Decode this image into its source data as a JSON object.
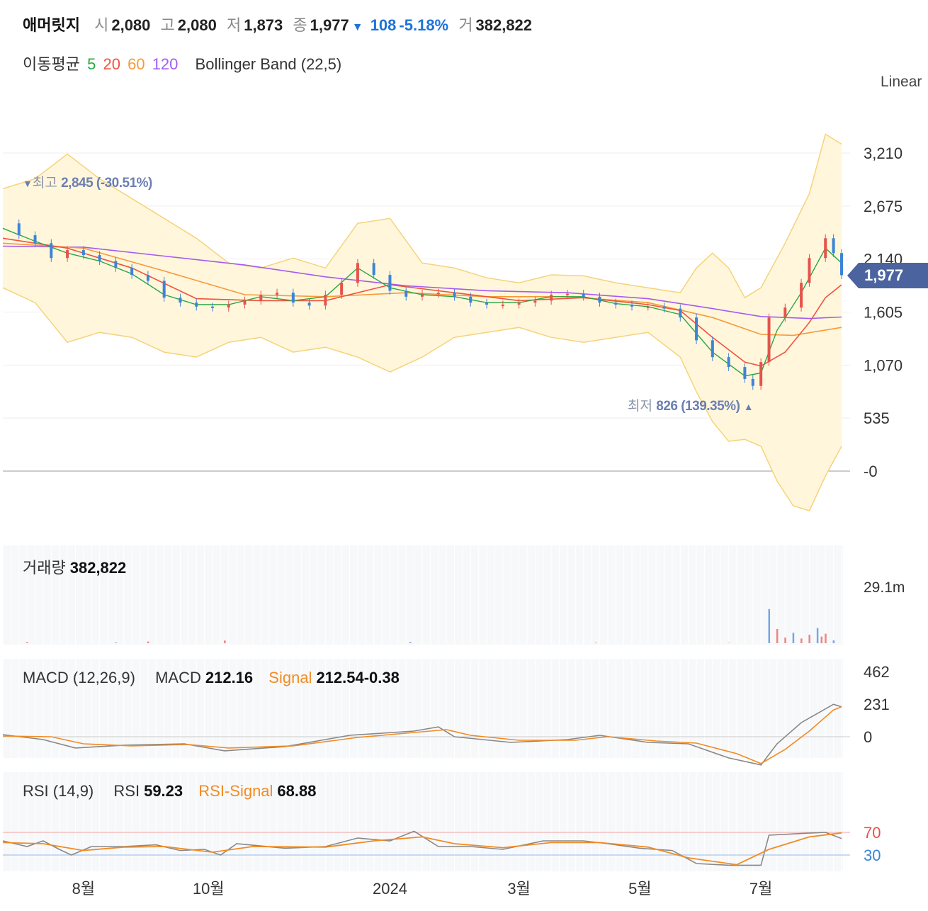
{
  "header": {
    "name": "애머릿지",
    "open_label": "시",
    "open": "2,080",
    "high_label": "고",
    "high": "2,080",
    "low_label": "저",
    "low": "1,873",
    "close_label": "종",
    "close": "1,977",
    "change_arrow": "▼",
    "change": "108",
    "change_pct": "-5.18%",
    "volume_label": "거",
    "volume": "382,822"
  },
  "indicators": {
    "ma_label": "이동평균",
    "ma_periods": [
      "5",
      "20",
      "60",
      "120"
    ],
    "ma_colors": [
      "#2aa744",
      "#f0533d",
      "#f59a3a",
      "#a55bf0"
    ],
    "bb_label": "Bollinger Band (22,5)",
    "scale_mode": "Linear"
  },
  "price_axis": {
    "ticks": [
      "3,210",
      "2,675",
      "2,140",
      "1,605",
      "1,070",
      "535",
      "-0"
    ],
    "current_price_tag": "1,977"
  },
  "annotations": {
    "high_marker": "▼",
    "high_label": "최고",
    "high_value": "2,845 (-30.51%)",
    "low_label": "최저",
    "low_value": "826 (139.35%)",
    "low_marker": "▲"
  },
  "volume_panel": {
    "label": "거래량",
    "value": "382,822",
    "axis_max": "29.1m"
  },
  "macd_panel": {
    "label": "MACD (12,26,9)",
    "macd_label": "MACD",
    "macd_value": "212.16",
    "signal_label": "Signal",
    "signal_value": "212.54",
    "hist_value": "-0.38",
    "ticks": [
      "462",
      "231",
      "0"
    ]
  },
  "rsi_panel": {
    "label": "RSI (14,9)",
    "rsi_label": "RSI",
    "rsi_value": "59.23",
    "signal_label": "RSI-Signal",
    "signal_value": "68.88",
    "ticks": [
      "70",
      "30"
    ]
  },
  "x_axis": {
    "ticks": [
      "8월",
      "10월",
      "2024",
      "3월",
      "5월",
      "7월"
    ]
  },
  "colors": {
    "up": "#e5534b",
    "down": "#3c84d8",
    "bb_fill": "#fff6dc",
    "bb_line": "#f6d37a",
    "signal": "#f28b23",
    "macd_line": "#888888",
    "tag_bg": "#4b64a0"
  },
  "chart_data": {
    "type": "line",
    "x_tick_labels": [
      "8월",
      "10월",
      "2024",
      "3월",
      "5월",
      "7월"
    ],
    "y_ticks": [
      3210,
      2675,
      2140,
      1605,
      1070,
      535,
      0
    ],
    "ylim": [
      -400,
      3500
    ],
    "close_path": [
      [
        0,
        2500
      ],
      [
        4,
        2380
      ],
      [
        8,
        2300
      ],
      [
        12,
        2150
      ],
      [
        16,
        2230
      ],
      [
        20,
        2180
      ],
      [
        24,
        2120
      ],
      [
        28,
        2050
      ],
      [
        32,
        1980
      ],
      [
        36,
        1920
      ],
      [
        40,
        1750
      ],
      [
        44,
        1700
      ],
      [
        48,
        1660
      ],
      [
        52,
        1650
      ],
      [
        56,
        1680
      ],
      [
        60,
        1720
      ],
      [
        64,
        1780
      ],
      [
        68,
        1800
      ],
      [
        72,
        1700
      ],
      [
        76,
        1670
      ],
      [
        80,
        1780
      ],
      [
        84,
        1900
      ],
      [
        88,
        2100
      ],
      [
        92,
        1980
      ],
      [
        96,
        1820
      ],
      [
        100,
        1760
      ],
      [
        104,
        1790
      ],
      [
        108,
        1800
      ],
      [
        112,
        1760
      ],
      [
        116,
        1700
      ],
      [
        120,
        1680
      ],
      [
        124,
        1680
      ],
      [
        128,
        1700
      ],
      [
        132,
        1720
      ],
      [
        136,
        1780
      ],
      [
        140,
        1790
      ],
      [
        144,
        1760
      ],
      [
        148,
        1700
      ],
      [
        152,
        1680
      ],
      [
        156,
        1660
      ],
      [
        160,
        1660
      ],
      [
        164,
        1640
      ],
      [
        168,
        1550
      ],
      [
        172,
        1320
      ],
      [
        176,
        1150
      ],
      [
        180,
        1050
      ],
      [
        184,
        930
      ],
      [
        186,
        860
      ],
      [
        188,
        1100
      ],
      [
        190,
        1550
      ],
      [
        194,
        1650
      ],
      [
        198,
        1900
      ],
      [
        200,
        2150
      ],
      [
        204,
        2350
      ],
      [
        206,
        2200
      ],
      [
        208,
        1977
      ]
    ],
    "ma5": [
      [
        0,
        2450
      ],
      [
        8,
        2320
      ],
      [
        16,
        2200
      ],
      [
        24,
        2120
      ],
      [
        32,
        1990
      ],
      [
        40,
        1780
      ],
      [
        48,
        1680
      ],
      [
        56,
        1680
      ],
      [
        64,
        1760
      ],
      [
        72,
        1720
      ],
      [
        80,
        1760
      ],
      [
        88,
        2050
      ],
      [
        96,
        1850
      ],
      [
        104,
        1780
      ],
      [
        112,
        1760
      ],
      [
        120,
        1700
      ],
      [
        128,
        1700
      ],
      [
        136,
        1760
      ],
      [
        144,
        1760
      ],
      [
        152,
        1690
      ],
      [
        160,
        1660
      ],
      [
        168,
        1580
      ],
      [
        176,
        1200
      ],
      [
        184,
        960
      ],
      [
        188,
        990
      ],
      [
        192,
        1420
      ],
      [
        198,
        1800
      ],
      [
        204,
        2250
      ],
      [
        208,
        2100
      ]
    ],
    "ma20": [
      [
        0,
        2350
      ],
      [
        16,
        2250
      ],
      [
        32,
        2050
      ],
      [
        48,
        1740
      ],
      [
        64,
        1720
      ],
      [
        80,
        1720
      ],
      [
        96,
        1880
      ],
      [
        112,
        1800
      ],
      [
        128,
        1720
      ],
      [
        144,
        1750
      ],
      [
        160,
        1680
      ],
      [
        168,
        1620
      ],
      [
        176,
        1350
      ],
      [
        184,
        1100
      ],
      [
        188,
        1060
      ],
      [
        194,
        1200
      ],
      [
        200,
        1500
      ],
      [
        204,
        1750
      ],
      [
        208,
        1880
      ]
    ],
    "ma60": [
      [
        0,
        2300
      ],
      [
        20,
        2250
      ],
      [
        40,
        2020
      ],
      [
        60,
        1780
      ],
      [
        80,
        1760
      ],
      [
        100,
        1800
      ],
      [
        120,
        1760
      ],
      [
        140,
        1760
      ],
      [
        160,
        1700
      ],
      [
        176,
        1550
      ],
      [
        188,
        1380
      ],
      [
        196,
        1370
      ],
      [
        208,
        1450
      ]
    ],
    "ma120": [
      [
        0,
        2270
      ],
      [
        20,
        2260
      ],
      [
        40,
        2170
      ],
      [
        60,
        2080
      ],
      [
        80,
        1960
      ],
      [
        100,
        1870
      ],
      [
        120,
        1820
      ],
      [
        140,
        1800
      ],
      [
        160,
        1740
      ],
      [
        176,
        1640
      ],
      [
        188,
        1560
      ],
      [
        200,
        1540
      ],
      [
        208,
        1555
      ]
    ],
    "bb_upper": [
      [
        0,
        2850
      ],
      [
        8,
        2950
      ],
      [
        16,
        3200
      ],
      [
        24,
        2950
      ],
      [
        32,
        2750
      ],
      [
        40,
        2550
      ],
      [
        48,
        2350
      ],
      [
        56,
        2100
      ],
      [
        64,
        2050
      ],
      [
        72,
        2150
      ],
      [
        80,
        2050
      ],
      [
        88,
        2500
      ],
      [
        96,
        2550
      ],
      [
        104,
        2100
      ],
      [
        112,
        2050
      ],
      [
        120,
        1950
      ],
      [
        128,
        1900
      ],
      [
        136,
        1980
      ],
      [
        144,
        1970
      ],
      [
        152,
        1900
      ],
      [
        160,
        1850
      ],
      [
        168,
        1800
      ],
      [
        172,
        2050
      ],
      [
        176,
        2200
      ],
      [
        180,
        2050
      ],
      [
        184,
        1750
      ],
      [
        188,
        1850
      ],
      [
        194,
        2300
      ],
      [
        200,
        2800
      ],
      [
        204,
        3400
      ],
      [
        208,
        3300
      ]
    ],
    "bb_lower": [
      [
        0,
        1850
      ],
      [
        8,
        1700
      ],
      [
        16,
        1300
      ],
      [
        24,
        1400
      ],
      [
        32,
        1350
      ],
      [
        40,
        1200
      ],
      [
        48,
        1150
      ],
      [
        56,
        1300
      ],
      [
        64,
        1350
      ],
      [
        72,
        1200
      ],
      [
        80,
        1250
      ],
      [
        88,
        1150
      ],
      [
        96,
        1000
      ],
      [
        104,
        1150
      ],
      [
        112,
        1350
      ],
      [
        120,
        1400
      ],
      [
        128,
        1450
      ],
      [
        136,
        1350
      ],
      [
        144,
        1300
      ],
      [
        152,
        1350
      ],
      [
        160,
        1400
      ],
      [
        168,
        1150
      ],
      [
        172,
        800
      ],
      [
        176,
        500
      ],
      [
        180,
        300
      ],
      [
        184,
        320
      ],
      [
        188,
        250
      ],
      [
        192,
        -100
      ],
      [
        196,
        -350
      ],
      [
        200,
        -400
      ],
      [
        204,
        -50
      ],
      [
        208,
        250
      ]
    ],
    "volume_spikes_m": [
      [
        6,
        0.6
      ],
      [
        28,
        0.4
      ],
      [
        36,
        0.9
      ],
      [
        55,
        1.4
      ],
      [
        101,
        0.6
      ],
      [
        147,
        0.3
      ],
      [
        180,
        0.2
      ],
      [
        190,
        18.0
      ],
      [
        192,
        7.5
      ],
      [
        194,
        3.0
      ],
      [
        196,
        5.5
      ],
      [
        198,
        2.5
      ],
      [
        200,
        4.5
      ],
      [
        202,
        8.0
      ],
      [
        203,
        3.5
      ],
      [
        204,
        5.0
      ],
      [
        206,
        1.5
      ]
    ],
    "macd_line": [
      [
        0,
        15
      ],
      [
        10,
        -20
      ],
      [
        18,
        -80
      ],
      [
        30,
        -60
      ],
      [
        45,
        -50
      ],
      [
        55,
        -100
      ],
      [
        70,
        -70
      ],
      [
        86,
        10
      ],
      [
        102,
        40
      ],
      [
        108,
        70
      ],
      [
        112,
        0
      ],
      [
        126,
        -40
      ],
      [
        140,
        -20
      ],
      [
        148,
        10
      ],
      [
        160,
        -40
      ],
      [
        170,
        -50
      ],
      [
        180,
        -150
      ],
      [
        188,
        -200
      ],
      [
        192,
        -50
      ],
      [
        198,
        100
      ],
      [
        206,
        230
      ],
      [
        208,
        212
      ]
    ],
    "macd_signal": [
      [
        0,
        5
      ],
      [
        12,
        0
      ],
      [
        20,
        -50
      ],
      [
        32,
        -65
      ],
      [
        46,
        -55
      ],
      [
        56,
        -80
      ],
      [
        72,
        -65
      ],
      [
        88,
        -5
      ],
      [
        104,
        35
      ],
      [
        110,
        50
      ],
      [
        116,
        10
      ],
      [
        128,
        -25
      ],
      [
        142,
        -25
      ],
      [
        150,
        0
      ],
      [
        162,
        -30
      ],
      [
        172,
        -45
      ],
      [
        182,
        -120
      ],
      [
        188,
        -190
      ],
      [
        194,
        -90
      ],
      [
        200,
        40
      ],
      [
        206,
        190
      ],
      [
        208,
        212
      ]
    ],
    "rsi": [
      [
        0,
        55
      ],
      [
        6,
        45
      ],
      [
        10,
        55
      ],
      [
        14,
        40
      ],
      [
        17,
        30
      ],
      [
        22,
        45
      ],
      [
        30,
        45
      ],
      [
        38,
        48
      ],
      [
        44,
        38
      ],
      [
        50,
        40
      ],
      [
        54,
        30
      ],
      [
        58,
        50
      ],
      [
        70,
        42
      ],
      [
        80,
        45
      ],
      [
        88,
        60
      ],
      [
        96,
        55
      ],
      [
        102,
        72
      ],
      [
        108,
        45
      ],
      [
        116,
        45
      ],
      [
        124,
        40
      ],
      [
        134,
        55
      ],
      [
        144,
        55
      ],
      [
        150,
        50
      ],
      [
        158,
        42
      ],
      [
        166,
        38
      ],
      [
        172,
        15
      ],
      [
        180,
        12
      ],
      [
        188,
        12
      ],
      [
        190,
        65
      ],
      [
        198,
        68
      ],
      [
        204,
        70
      ],
      [
        208,
        59
      ]
    ],
    "rsi_signal": [
      [
        0,
        52
      ],
      [
        10,
        50
      ],
      [
        20,
        38
      ],
      [
        30,
        44
      ],
      [
        40,
        45
      ],
      [
        52,
        35
      ],
      [
        62,
        45
      ],
      [
        80,
        44
      ],
      [
        92,
        55
      ],
      [
        104,
        62
      ],
      [
        112,
        50
      ],
      [
        124,
        43
      ],
      [
        136,
        52
      ],
      [
        148,
        52
      ],
      [
        160,
        44
      ],
      [
        170,
        25
      ],
      [
        182,
        13
      ],
      [
        190,
        40
      ],
      [
        200,
        62
      ],
      [
        208,
        69
      ]
    ]
  }
}
